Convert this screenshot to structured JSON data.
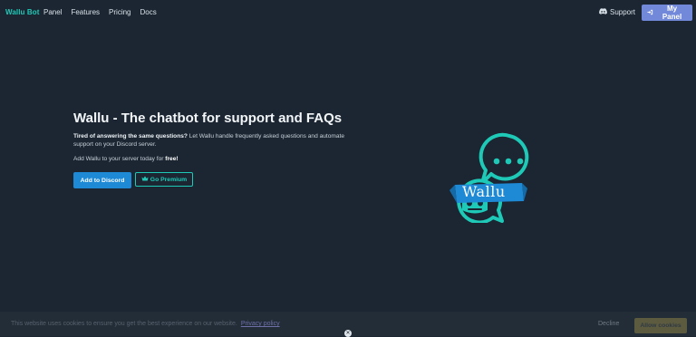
{
  "nav": {
    "brand": "Wallu Bot",
    "links": [
      "Panel",
      "Features",
      "Pricing",
      "Docs"
    ],
    "support_label": "Support",
    "panel_label": "My Panel"
  },
  "hero": {
    "title": "Wallu - The chatbot for support and FAQs",
    "desc_bold": "Tired of answering the same questions?",
    "desc_rest": " Let Wallu handle frequently asked questions and automate support on your Discord server.",
    "cta_text": "Add Wallu to your server today for ",
    "cta_bold": "free!",
    "add_button": "Add to Discord",
    "premium_button": "Go Premium"
  },
  "logo": {
    "banner_text": "Wallu"
  },
  "cookie": {
    "message": "This website uses cookies to ensure you get the best experience on our website.",
    "policy_link": "Privacy policy",
    "decline": "Decline",
    "allow": "Allow cookies"
  },
  "colors": {
    "background": "#1b2632",
    "accent_teal": "#1fc9b7",
    "discord_blue": "#1e8ad6",
    "panel_purple": "#7289da"
  },
  "icons": {
    "support": "discord-icon",
    "panel": "login-icon",
    "premium": "crown-icon",
    "close": "close-icon"
  }
}
